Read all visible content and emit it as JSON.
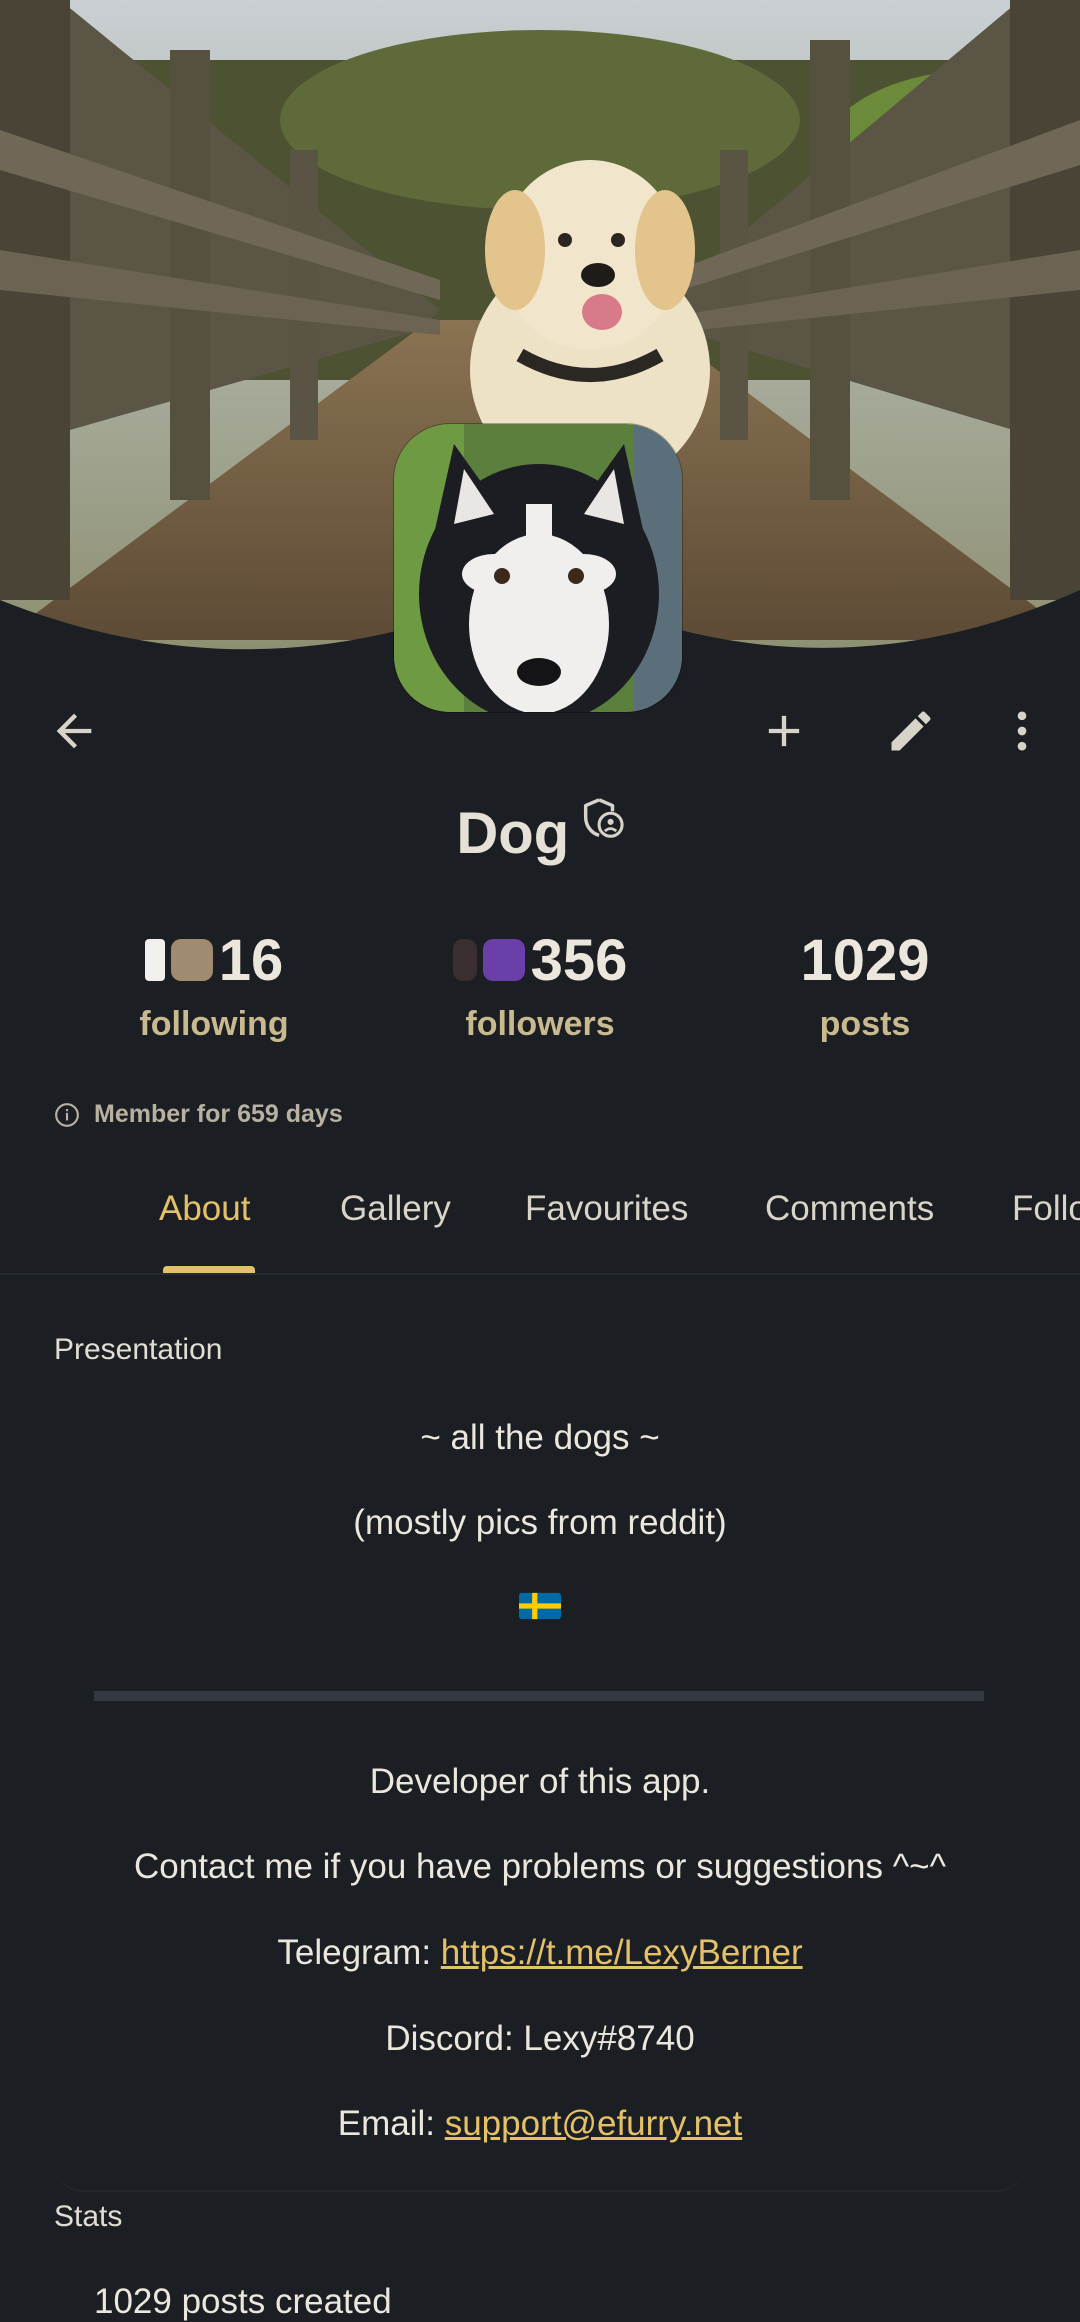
{
  "profile": {
    "name": "Dog",
    "member_text": "Member for 659 days"
  },
  "stats": {
    "following": {
      "count": "16",
      "label": "following"
    },
    "followers": {
      "count": "356",
      "label": "followers"
    },
    "posts": {
      "count": "1029",
      "label": "posts"
    }
  },
  "tabs": [
    {
      "label": "About",
      "active": true
    },
    {
      "label": "Gallery"
    },
    {
      "label": "Favourites"
    },
    {
      "label": "Comments"
    },
    {
      "label": "Follo"
    }
  ],
  "about": {
    "section_title": "Presentation",
    "line1": "~ all the dogs ~",
    "line2": "(mostly pics from reddit)",
    "flag": "🇸🇪",
    "line3": "Developer of this app.",
    "line4": "Contact me if you have problems or suggestions ^~^",
    "telegram_label": "Telegram: ",
    "telegram_link": "https://t.me/LexyBerner",
    "discord": "Discord: Lexy#8740",
    "email_label": "Email: ",
    "email_link": "support@efurry.net"
  },
  "stats_section": {
    "title": "Stats",
    "posts_created": "1029 posts created"
  },
  "icons": {
    "back": "arrow-left-icon",
    "add": "plus-icon",
    "edit": "pencil-icon",
    "more": "more-vertical-icon",
    "info": "info-icon",
    "badge": "shield-user-icon"
  },
  "colors": {
    "background": "#1b1e23",
    "accent": "#e4c168",
    "label": "#c9b98e"
  }
}
